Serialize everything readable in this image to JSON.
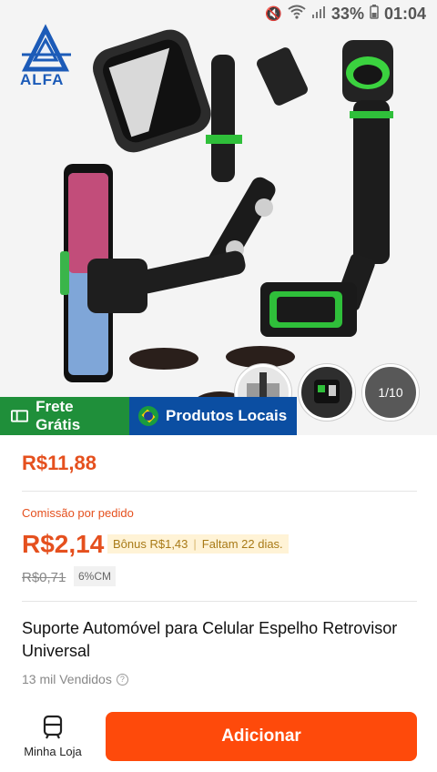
{
  "status": {
    "battery": "33%",
    "time": "01:04",
    "icons": [
      "mute-icon",
      "wifi-icon",
      "signal-icon",
      "battery-icon"
    ]
  },
  "brand": {
    "logo_text": "ALFA"
  },
  "gallery": {
    "counter": "1/10"
  },
  "promo": {
    "frete_label": "Frete Grátis",
    "produtos_label": "Produtos Locais"
  },
  "product": {
    "price": "R$11,88",
    "commission_label": "Comissão por pedido",
    "commission_value": "R$2,14",
    "bonus": "Bônus R$1,43",
    "remaining": "Faltam 22 dias.",
    "old_price": "R$0,71",
    "cm_rate": "6%CM",
    "title": "Suporte Automóvel para Celular Espelho Retrovisor Universal",
    "sold": "13 mil Vendidos"
  },
  "actions": {
    "shop_label": "Minha Loja",
    "add_label": "Adicionar"
  },
  "colors": {
    "accent": "#fe4a0b",
    "price": "#e5501e",
    "frete_bg": "#1f8f3a",
    "produtos_bg": "#0b4ea2",
    "bonus_bg": "#fff3d6"
  }
}
